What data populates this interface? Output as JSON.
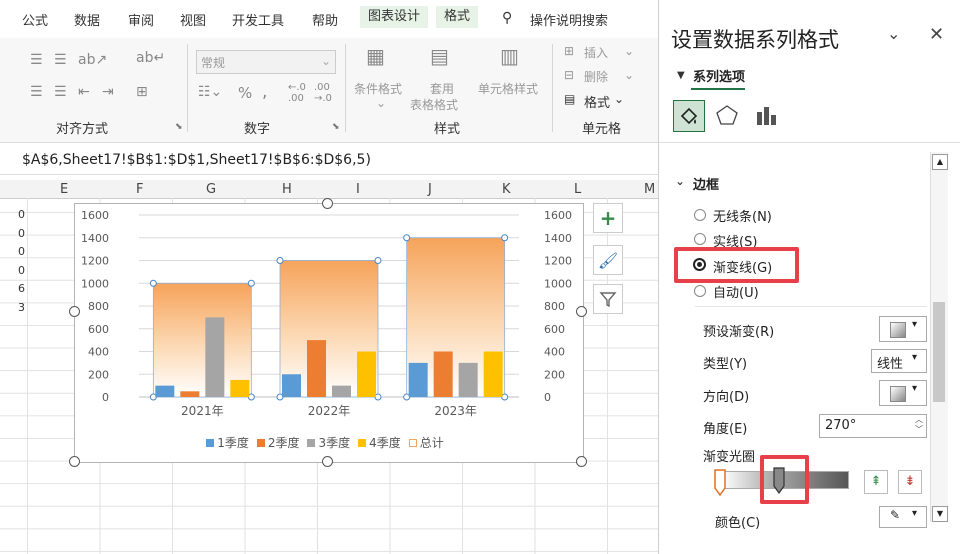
{
  "ribbon": {
    "tabs": [
      "公式",
      "数据",
      "审阅",
      "视图",
      "开发工具",
      "帮助",
      "图表设计",
      "格式",
      "操作说明搜索"
    ],
    "groups": {
      "alignment": "对齐方式",
      "number": "数字",
      "styles": "样式",
      "cells": "单元格"
    },
    "number_format": "常规",
    "styles_buttons": {
      "conditional": "条件格式",
      "table_format_1": "套用",
      "table_format_2": "表格格式",
      "cell_style": "单元格样式"
    },
    "cells_buttons": {
      "insert": "插入",
      "delete": "删除",
      "format": "格式"
    }
  },
  "formula": "$A$6,Sheet17!$B$1:$D$1,Sheet17!$B$6:$D$6,5)",
  "columns": [
    "E",
    "F",
    "G",
    "H",
    "I",
    "J",
    "K",
    "L",
    "M"
  ],
  "row_fragments": [
    "0",
    "0",
    "0",
    "0",
    "6",
    "3"
  ],
  "chart_data": {
    "type": "bar",
    "categories": [
      "2021年",
      "2022年",
      "2023年"
    ],
    "series": [
      {
        "name": "1季度",
        "values": [
          100,
          200,
          300
        ],
        "color": "#5b9bd5"
      },
      {
        "name": "2季度",
        "values": [
          50,
          500,
          400
        ],
        "color": "#ed7d31"
      },
      {
        "name": "3季度",
        "values": [
          700,
          100,
          300
        ],
        "color": "#a5a5a5"
      },
      {
        "name": "4季度",
        "values": [
          150,
          400,
          400
        ],
        "color": "#ffc000"
      },
      {
        "name": "总计",
        "values": [
          1000,
          1200,
          1400
        ],
        "color": "#f4a460"
      }
    ],
    "ylim": [
      0,
      1600
    ],
    "yticks": [
      0,
      200,
      400,
      600,
      800,
      1000,
      1200,
      1400,
      1600
    ],
    "legend_position": "bottom",
    "gridlines": true
  },
  "pane": {
    "title": "设置数据系列格式",
    "section_tab": "系列选项",
    "section": "边框",
    "options": [
      "无线条(N)",
      "实线(S)",
      "渐变线(G)",
      "自动(U)"
    ],
    "selected_option": "渐变线(G)",
    "preset_label": "预设渐变(R)",
    "type_label": "类型(Y)",
    "type_value": "线性",
    "direction_label": "方向(D)",
    "angle_label": "角度(E)",
    "angle_value": "270°",
    "stops_label": "渐变光圈",
    "color_label": "颜色(C)"
  },
  "colors": {
    "accent": "#217346",
    "highlight": "#e8404a"
  }
}
